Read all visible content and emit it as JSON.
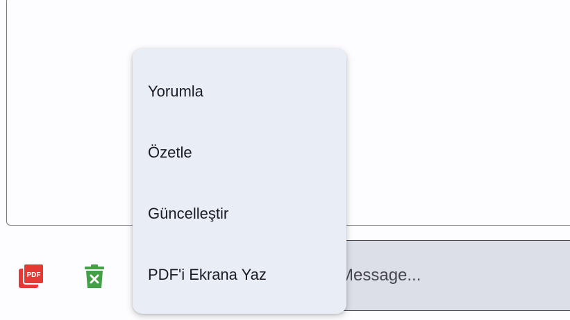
{
  "composer": {
    "placeholder": "Message..."
  },
  "toolbar": {
    "pdf_icon": "pdf-icon",
    "pdf_icon_text": "PDF",
    "pdf_color": "#e53935",
    "delete_icon": "trash-icon",
    "delete_color": "#43a047"
  },
  "popup_menu": {
    "items": [
      {
        "label": "Yorumla"
      },
      {
        "label": "Özetle"
      },
      {
        "label": "Güncelleştir"
      },
      {
        "label": "PDF'i Ekrana Yaz"
      }
    ]
  }
}
